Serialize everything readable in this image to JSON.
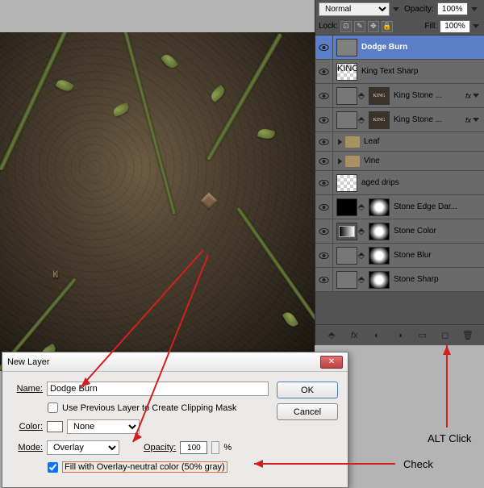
{
  "blend_mode": "Normal",
  "opacity_label": "Opacity:",
  "opacity_value": "100%",
  "lock_label": "Lock:",
  "fill_label": "Fill:",
  "fill_value": "100%",
  "king_text": "Kin",
  "layers": [
    {
      "name": "Dodge Burn",
      "thumb": "gray",
      "selected": true
    },
    {
      "name": "King Text Sharp",
      "thumb": "checker",
      "king": true
    },
    {
      "name": "King Stone ...",
      "thumb": "noise",
      "mask": true,
      "king": true,
      "fx": true
    },
    {
      "name": "King Stone ...",
      "thumb": "noise",
      "mask": true,
      "king": true,
      "fx": true
    },
    {
      "name": "Leaf",
      "group": true
    },
    {
      "name": "Vine",
      "group": true
    },
    {
      "name": "aged drips",
      "thumb": "checker"
    },
    {
      "name": "Stone Edge Dar...",
      "thumb": "black",
      "mask": true,
      "levels": true
    },
    {
      "name": "Stone Color",
      "thumb": "levels",
      "mask": true,
      "levels_primary": true
    },
    {
      "name": "Stone Blur",
      "thumb": "noise",
      "mask": true
    },
    {
      "name": "Stone Sharp",
      "thumb": "noise",
      "mask": true
    }
  ],
  "dialog": {
    "title": "New Layer",
    "name_label": "Name:",
    "name_value": "Dodge Burn",
    "clip_label": "Use Previous Layer to Create Clipping Mask",
    "color_label": "Color:",
    "color_value": "None",
    "mode_label": "Mode:",
    "mode_value": "Overlay",
    "opacity_label": "Opacity:",
    "opacity_value": "100",
    "percent": "%",
    "fill_label": "Fill with Overlay-neutral color (50% gray)",
    "ok": "OK",
    "cancel": "Cancel"
  },
  "anno_alt": "ALT Click",
  "anno_check": "Check"
}
